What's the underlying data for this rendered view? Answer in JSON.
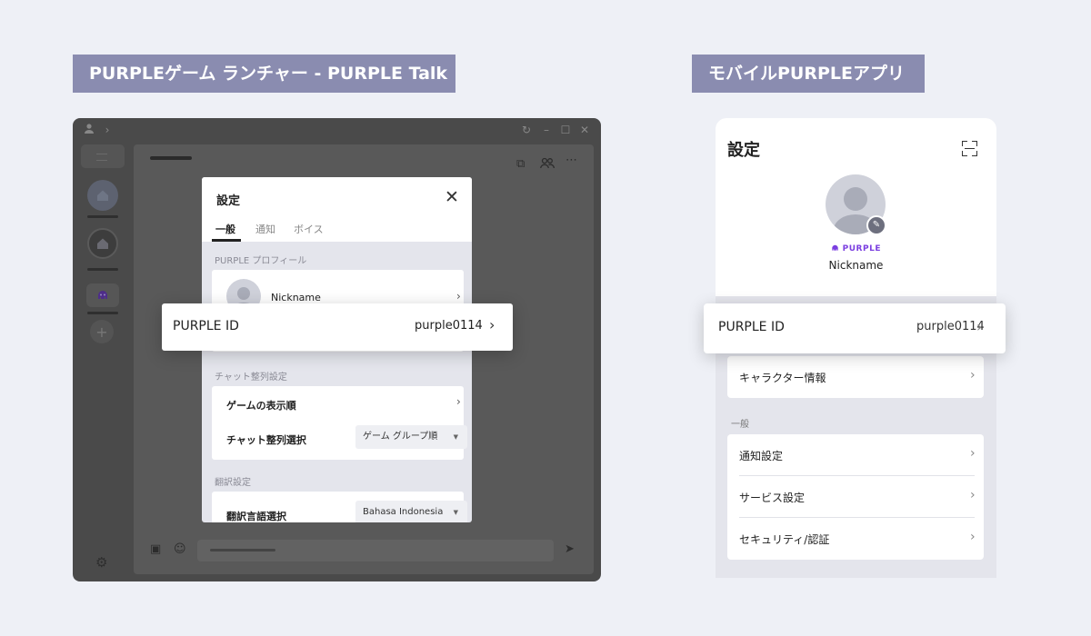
{
  "headers": {
    "left": "PURPLEゲーム ランチャー - PURPLE Talk",
    "right": "モバイルPURPLEアプリ"
  },
  "desktop": {
    "titlebar": {
      "icons": [
        "user-icon",
        "chevron-right-icon",
        "refresh-icon",
        "minimize-icon",
        "maximize-icon",
        "close-icon"
      ],
      "glyphs": {
        "refresh": "↻",
        "minimize": "–",
        "maximize": "☐",
        "close": "✕",
        "chevron": "›"
      }
    },
    "rail": {
      "add_glyph": "+",
      "settings_glyph": "⚙"
    },
    "chat_toolbar": {
      "tv": "⧉",
      "people": "👥",
      "more": "⋯"
    },
    "chat_footer": {
      "image": "▣",
      "emoji": "☺",
      "send": "➤"
    },
    "dialog": {
      "title": "設定",
      "close_glyph": "✕",
      "tabs": [
        "一般",
        "通知",
        "ボイス"
      ],
      "active_tab": 0,
      "profile_section": "PURPLE プロフィール",
      "nickname": "Nickname",
      "chat_section": "チャット整列設定",
      "game_order": "ゲームの表示順",
      "chat_sort": "チャット整列選択",
      "chat_sort_value": "ゲーム グループ順",
      "translate_section": "翻訳設定",
      "translate_lang": "翻訳言語選択",
      "translate_lang_value": "Bahasa Indonesia",
      "chevron": "›",
      "caret": "▼"
    },
    "id_card": {
      "label": "PURPLE ID",
      "value": "purple0114",
      "chevron": "›"
    }
  },
  "mobile": {
    "title": "設定",
    "brand": "PURPLE",
    "brand_color": "#7b3fe0",
    "nickname": "Nickname",
    "edit_glyph": "✎",
    "id_card": {
      "label": "PURPLE ID",
      "value": "purple0114",
      "chevron": "›"
    },
    "character_info": "キャラクター情報",
    "general_section": "一般",
    "items": [
      "通知設定",
      "サービス設定",
      "セキュリティ/認証"
    ],
    "chevron": "›"
  },
  "colors": {
    "background": "#eef0f6",
    "header_label": "#8a8cb0",
    "window_dim": "#4a4a4a",
    "accent_purple": "#7b3fe0"
  }
}
